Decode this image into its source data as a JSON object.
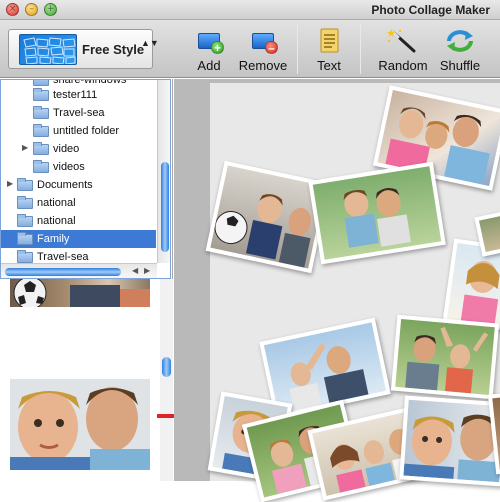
{
  "window": {
    "title": "Photo Collage Maker",
    "close_glyph": "×",
    "minimize_glyph": "–",
    "maximize_glyph": "+"
  },
  "toolbar": {
    "style_selector": {
      "value": "Free Style",
      "icon": "collage-template-thumbnail",
      "arrows": "▲▼"
    },
    "add_label": "Add",
    "remove_label": "Remove",
    "text_label": "Text",
    "random_label": "Random",
    "shuffle_label": "Shuffle",
    "add_badge": "+",
    "remove_badge": "–"
  },
  "folder_tree": {
    "items": [
      {
        "label": "share-windows",
        "disclosure": "",
        "selected": false
      },
      {
        "label": "tester111",
        "disclosure": "",
        "selected": false
      },
      {
        "label": "Travel-sea",
        "disclosure": "",
        "selected": false
      },
      {
        "label": "untitled folder",
        "disclosure": "",
        "selected": false
      },
      {
        "label": "video",
        "disclosure": "▶",
        "selected": false
      },
      {
        "label": "videos",
        "disclosure": "",
        "selected": false
      },
      {
        "label": "Documents",
        "disclosure": "▶",
        "selected": false
      },
      {
        "label": "national",
        "disclosure": "",
        "selected": false
      },
      {
        "label": "national",
        "disclosure": "",
        "selected": false
      },
      {
        "label": "Family",
        "disclosure": "",
        "selected": true
      },
      {
        "label": "Travel-sea",
        "disclosure": "",
        "selected": false
      }
    ],
    "scroll_left": "◀",
    "scroll_right": "▶"
  },
  "colors": {
    "selection": "#3d7ad6",
    "scroll_thumb": "#2e7fe0",
    "canvas_bg": "#e8e8e8",
    "arrow": "#e0232b"
  }
}
